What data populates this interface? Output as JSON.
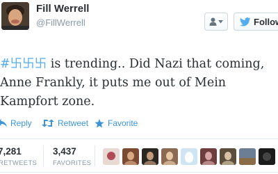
{
  "user": {
    "display_name": "Fill Werrell",
    "username": "@FillWerrell"
  },
  "header": {
    "follow_label": "Follow"
  },
  "tweet": {
    "hashtag": "#卐卐卐",
    "line1_rest": " is trending.. Did Nazi that coming,",
    "line2": "Anne Frankly, it puts me out of Mein",
    "line3": "Kampfort zone."
  },
  "actions": {
    "reply_label": "Reply",
    "retweet_label": "Retweet",
    "favorite_label": "Favorite"
  },
  "stats": {
    "retweets_count": "7,281",
    "retweets_label": "RETWEETS",
    "favorites_count": "3,437",
    "favorites_label": "FAVORITES"
  },
  "colors": {
    "link_blue": "#3b94d9",
    "hashtag_blue": "#55acee",
    "text": "#292f33",
    "muted": "#8899a6",
    "border": "#e1e8ed"
  },
  "favoriters": [
    {
      "icon": "profile-thumbnail-rose",
      "bg": "#e8d9d3",
      "fg": "#b04a5a"
    },
    {
      "icon": "profile-thumbnail-photo",
      "bg": "#7a4a32",
      "fg": "#d9a982"
    },
    {
      "icon": "profile-thumbnail-photo",
      "bg": "#2a2622",
      "fg": "#c49a7a"
    },
    {
      "icon": "profile-thumbnail-photo",
      "bg": "#8c6a52",
      "fg": "#e8c9a6"
    },
    {
      "icon": "profile-thumbnail-egg",
      "bg": "#cfe5f3",
      "fg": "#ffffff"
    },
    {
      "icon": "profile-thumbnail-photo",
      "bg": "#6e3d3d",
      "fg": "#d7a7a7"
    },
    {
      "icon": "profile-thumbnail-photo",
      "bg": "#5b4e3d",
      "fg": "#d6c3a4"
    },
    {
      "icon": "profile-thumbnail-landscape",
      "bg": "#6b7e94",
      "fg": "#8b6a48"
    },
    {
      "icon": "profile-thumbnail-dark",
      "bg": "#1b1b1b",
      "fg": "#444444"
    }
  ]
}
